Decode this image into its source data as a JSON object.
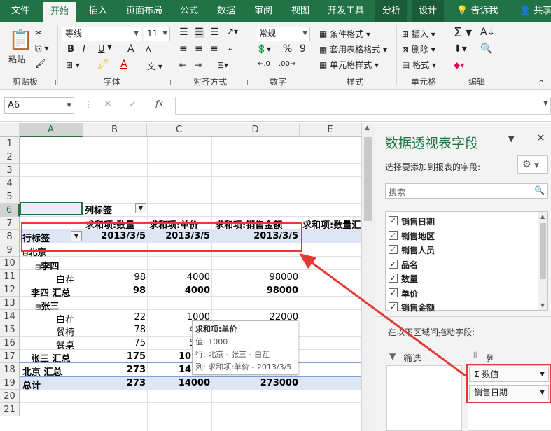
{
  "tabs": [
    "文件",
    "开始",
    "插入",
    "页面布局",
    "公式",
    "数据",
    "审阅",
    "视图",
    "开发工具",
    "分析",
    "设计"
  ],
  "tell_me": "告诉我",
  "share": "共享",
  "ribbon": {
    "clipboard": {
      "paste": "粘贴",
      "label": "剪贴板"
    },
    "font": {
      "name": "等线",
      "size": "11",
      "bold": "B",
      "italic": "I",
      "underline": "U",
      "grow": "A",
      "shrink": "A",
      "label": "字体"
    },
    "align": {
      "label": "对齐方式"
    },
    "number": {
      "format": "常规",
      "percent": "%",
      "comma": "9",
      "label": "数字"
    },
    "styles": {
      "cond": "条件格式",
      "table": "套用表格格式",
      "cell": "单元格样式",
      "label": "样式"
    },
    "cells": {
      "insert": "插入",
      "delete": "删除",
      "format": "格式",
      "label": "单元格"
    },
    "edit": {
      "label": "编辑"
    }
  },
  "formula_bar": {
    "name_box": "A6",
    "fx": "fx",
    "value": ""
  },
  "columns": [
    "A",
    "B",
    "C",
    "D",
    "E"
  ],
  "rows": [
    "1",
    "2",
    "3",
    "4",
    "5",
    "6",
    "7",
    "8",
    "9",
    "10",
    "11",
    "12",
    "13",
    "14",
    "15",
    "16",
    "17",
    "18",
    "19",
    "20",
    "21"
  ],
  "pivot": {
    "col_label": "列标签",
    "headers": [
      "求和项:数量",
      "求和项:单价",
      "求和项:销售金额",
      "求和项:数量汇"
    ],
    "row_label": "行标签",
    "dates": [
      "2013/3/5",
      "2013/3/5",
      "2013/3/5"
    ],
    "r9": "北京",
    "r10": "李四",
    "r11": {
      "name": "白茬",
      "qty": "98",
      "price": "4000",
      "amount": "98000"
    },
    "r12": {
      "name": "李四 汇总",
      "qty": "98",
      "price": "4000",
      "amount": "98000"
    },
    "r13": "张三",
    "r14": {
      "name": "白茬",
      "qty": "22",
      "price": "1000",
      "amount": "22000"
    },
    "r15": {
      "name": "餐椅",
      "qty": "78",
      "price": "4"
    },
    "r16": {
      "name": "餐桌",
      "qty": "75",
      "price": "5"
    },
    "r17": {
      "name": "张三 汇总",
      "qty": "175",
      "price": "10"
    },
    "r18": {
      "name": "北京 汇总",
      "qty": "273",
      "price": "14"
    },
    "r19": {
      "name": "总计",
      "qty": "273",
      "price": "14000",
      "amount": "273000"
    }
  },
  "tooltip": {
    "title": "求和项:单价",
    "value": "值: 1000",
    "row": "行: 北京 - 张三 - 白茬",
    "col": "列: 求和项:单价 - 2013/3/5"
  },
  "pane": {
    "title": "数据透视表字段",
    "subtitle": "选择要添加到报表的字段:",
    "search_placeholder": "搜索",
    "fields": [
      "销售日期",
      "销售地区",
      "销售人员",
      "品名",
      "数量",
      "单价",
      "销售金额"
    ],
    "drag_hint": "在以下区域间拖动字段:",
    "filter_label": "筛选",
    "column_label": "列",
    "values_chip": "Σ 数值",
    "date_chip": "销售日期"
  },
  "colors": {
    "excel_green": "#217346",
    "highlight_red": "#e53935",
    "pivot_row_bg": "#dce6f4"
  }
}
